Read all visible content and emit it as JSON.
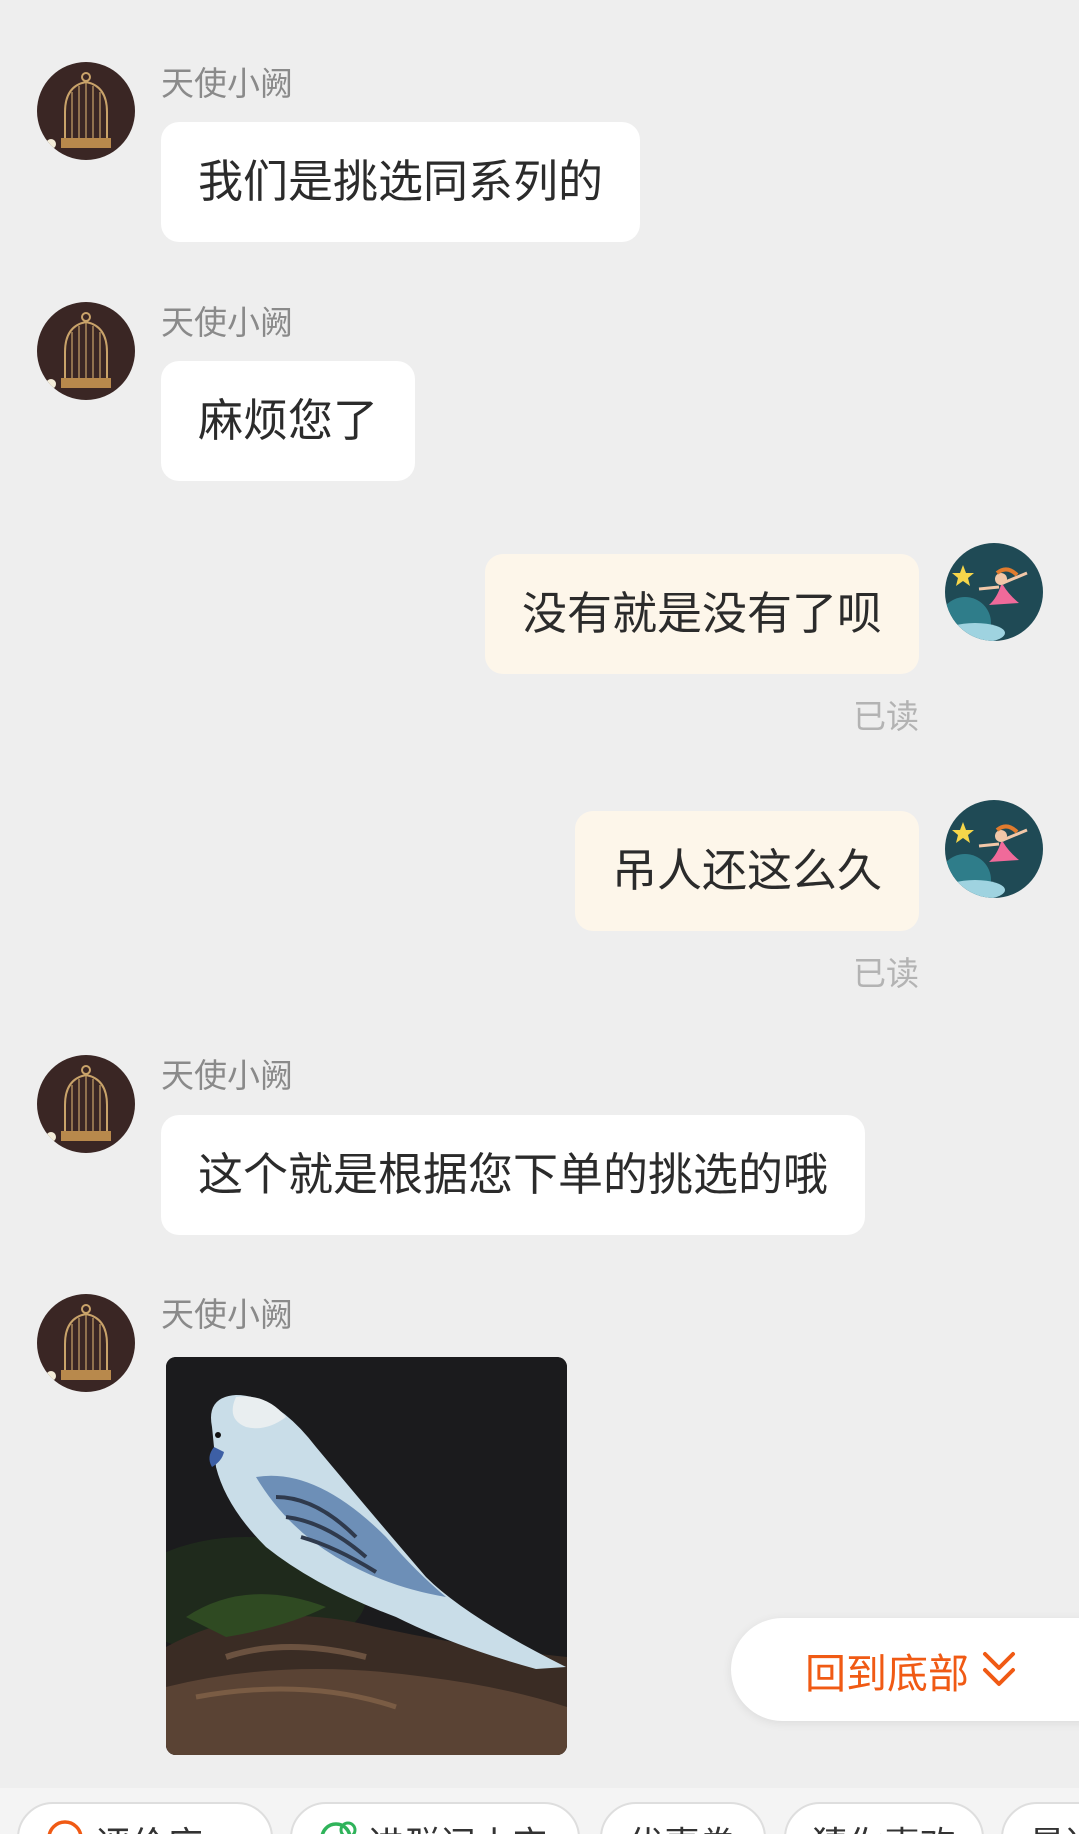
{
  "contact": {
    "name": "天使小阙"
  },
  "messages": [
    {
      "side": "left",
      "sender": "天使小阙",
      "text": "我们是挑选同系列的"
    },
    {
      "side": "left",
      "sender": "天使小阙",
      "text": "麻烦您了"
    },
    {
      "side": "right",
      "text": "没有就是没有了呗",
      "status": "已读"
    },
    {
      "side": "right",
      "text": "吊人还这么久",
      "status": "已读"
    },
    {
      "side": "left",
      "sender": "天使小阙",
      "text": "这个就是根据您下单的挑选的哦"
    },
    {
      "side": "left",
      "sender": "天使小阙",
      "image": "budgerigar-photo"
    }
  ],
  "scroll_to_bottom": {
    "label": "回到底部",
    "icon": "double-chevron-down-icon"
  },
  "quick_actions": [
    {
      "label": "评价店",
      "icon": "circle-icon"
    },
    {
      "label": "进群问小宝",
      "icon": "chat-icon"
    },
    {
      "label": "优惠券"
    },
    {
      "label": "猜你喜欢"
    },
    {
      "label": "最近"
    }
  ],
  "colors": {
    "background": "#eeeeee",
    "incoming_bubble": "#ffffff",
    "outgoing_bubble": "#fdf6ea",
    "accent": "#f05a14"
  }
}
